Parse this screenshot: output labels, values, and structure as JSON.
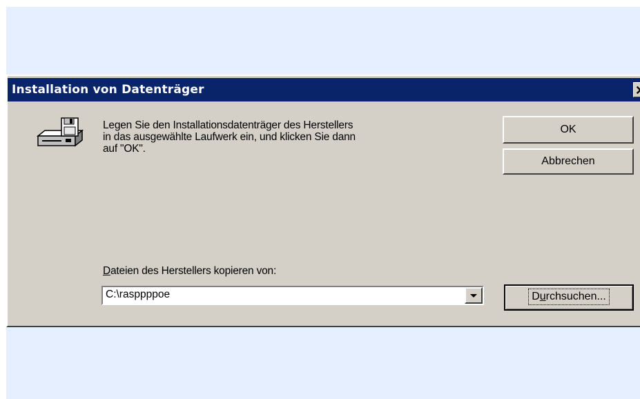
{
  "dialog": {
    "title": "Installation von Datenträger",
    "close_glyph": "✕",
    "message_lines": [
      "Legen Sie den Installationsdatenträger des Herstellers",
      "in das ausgewählte Laufwerk ein, und klicken Sie dann",
      "auf \"OK\"."
    ],
    "ok_label": "OK",
    "cancel_label": "Abbrechen",
    "copy_from_label_accel": "D",
    "copy_from_label_rest": "ateien des Herstellers kopieren von:",
    "path_value": "C:\\rasppppoe",
    "browse_label_pre": "D",
    "browse_label_accel": "u",
    "browse_label_rest": "rchsuchen...",
    "icon": "disk-drive-icon",
    "colors": {
      "titlebar": "#0a246a",
      "face": "#d4d0c8",
      "page_background": "#e6efff"
    }
  }
}
